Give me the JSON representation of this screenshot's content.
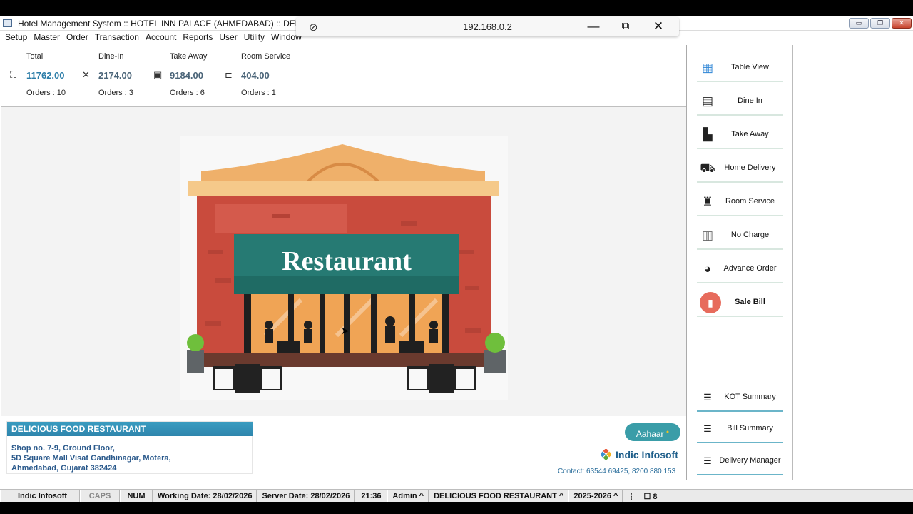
{
  "window": {
    "title": "Hotel Management System :: HOTEL INN PALACE (AHMEDABAD) :: DELICIOUS",
    "controls": {
      "minimize": "▭",
      "restore": "❐",
      "close": "✕"
    }
  },
  "remote_bar": {
    "ip": "192.168.0.2",
    "pin_icon": "unpin-icon",
    "minimize": "—",
    "restore": "⧉",
    "close": "✕"
  },
  "menu": [
    "Setup",
    "Master",
    "Order",
    "Transaction",
    "Account",
    "Reports",
    "User",
    "Utility",
    "Window"
  ],
  "stats": [
    {
      "label": "Total",
      "amount": "11762.00",
      "orders": "Orders : 10",
      "icon": "⛶"
    },
    {
      "label": "Dine-In",
      "amount": "2174.00",
      "orders": "Orders : 3",
      "icon": "✕"
    },
    {
      "label": "Take Away",
      "amount": "9184.00",
      "orders": "Orders : 6",
      "icon": "▣"
    },
    {
      "label": "Room Service",
      "amount": "404.00",
      "orders": "Orders : 1",
      "icon": "⊏"
    }
  ],
  "illustration": {
    "sign_text": "Restaurant"
  },
  "sidebar": {
    "buttons": [
      {
        "label": "Table View",
        "icon": "▦",
        "color": "#2f86d6"
      },
      {
        "label": "Dine In",
        "icon": "▤",
        "color": "#222222"
      },
      {
        "label": "Take Away",
        "icon": "▙",
        "color": "#222222"
      },
      {
        "label": "Home Delivery",
        "icon": "⛟",
        "color": "#222222"
      },
      {
        "label": "Room Service",
        "icon": "♜",
        "color": "#222222"
      },
      {
        "label": "No Charge",
        "icon": "▥",
        "color": "#666666"
      },
      {
        "label": "Advance Order",
        "icon": "◕",
        "color": "#111111"
      },
      {
        "label": "Sale Bill",
        "icon": "▮"
      }
    ],
    "summaries": [
      {
        "label": "KOT Summary",
        "icon": "☰"
      },
      {
        "label": "Bill Summary",
        "icon": "☰"
      },
      {
        "label": "Delivery Manager",
        "icon": "☰"
      }
    ]
  },
  "footer": {
    "restaurant_name": "DELICIOUS FOOD RESTAURANT",
    "address_lines": [
      "Shop no. 7-9, Ground Floor,",
      "5D Square Mall Visat Gandhinagar, Motera,",
      "Ahmedabad, Gujarat 382424"
    ],
    "aahaar_label": "Aahaar",
    "company": "Indic Infosoft",
    "contact": "Contact: 63544 69425, 8200 880 153"
  },
  "statusbar": {
    "items": [
      "Indic Infosoft",
      "CAPS",
      "NUM",
      "Working Date: 28/02/2026",
      "Server Date: 28/02/2026",
      "21:36",
      "Admin ^",
      "DELICIOUS FOOD RESTAURANT ^",
      "2025-2026 ^"
    ],
    "trailing": "8"
  },
  "colors": {
    "accent": "#2e85ad",
    "amount_total": "#2c7da8",
    "aahaar": "#3a9da8",
    "sale_bill": "#e76b5c"
  }
}
